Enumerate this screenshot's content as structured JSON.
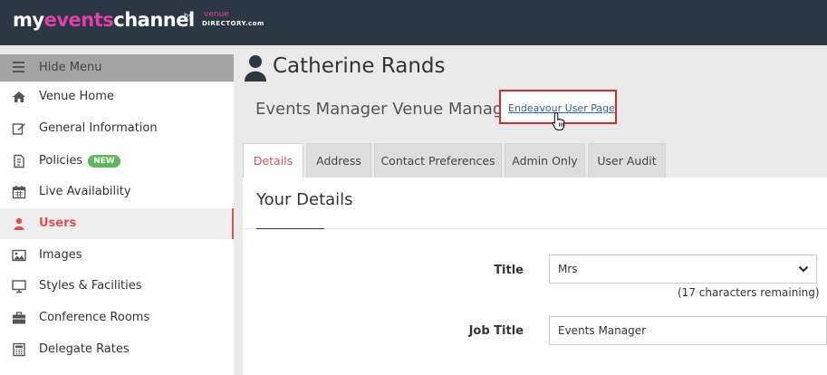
{
  "brand": {
    "logo_my": "my",
    "logo_events": "events",
    "logo_channel": "channel",
    "by": "by",
    "venue": "venue",
    "directory": "DIRECTORY.com",
    "accent": "#e040a8",
    "topbar_color": "#2b3843"
  },
  "sidebar": {
    "hide_menu_label": "Hide Menu",
    "items": [
      {
        "label": "Venue Home",
        "icon": "home-icon"
      },
      {
        "label": "General Information",
        "icon": "edit-icon"
      },
      {
        "label": "Policies",
        "icon": "document-icon",
        "badge": "NEW"
      },
      {
        "label": "Live Availability",
        "icon": "calendar-icon"
      },
      {
        "label": "Users",
        "icon": "user-icon",
        "active": true
      },
      {
        "label": "Images",
        "icon": "image-icon"
      },
      {
        "label": "Styles & Facilities",
        "icon": "monitor-icon"
      },
      {
        "label": "Conference Rooms",
        "icon": "briefcase-icon"
      },
      {
        "label": "Delegate Rates",
        "icon": "calculator-icon"
      }
    ],
    "active_color": "#d9534f"
  },
  "main": {
    "title": "Catherine Rands",
    "subtitle": "Events Manager Venue Manager",
    "endeavour_link": "Endeavour User Page",
    "tabs": [
      "Details",
      "Address",
      "Contact Preferences",
      "Admin Only",
      "User Audit"
    ],
    "active_tab": "Details",
    "panel_title": "Your Details",
    "form": {
      "title_label": "Title",
      "title_value": "Mrs",
      "title_remaining": "(17 characters remaining)",
      "job_title_label": "Job Title",
      "job_title_value": "Events Manager"
    }
  }
}
